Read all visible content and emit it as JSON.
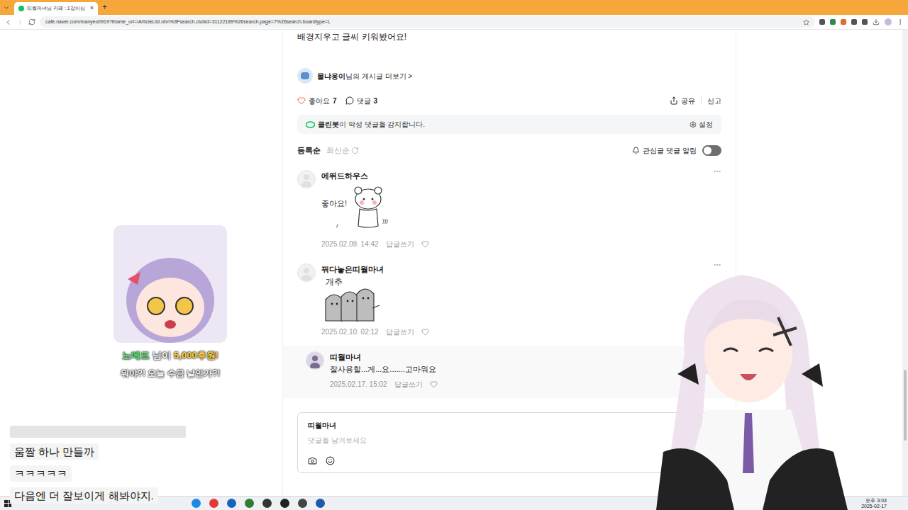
{
  "browser": {
    "tab_title": "띠월마녀님 카페 : 1강이심",
    "url": "cafe.naver.com/manyeo0919?iframe_url=/ArticleList.nhn%3Fsearch.clubid=31122189%26search.page=7%26search.boardtype=L",
    "close": "×",
    "new_tab": "+"
  },
  "post": {
    "text": "배경지우고 글씨 키워봤어요!",
    "author": "물냐옹이",
    "more": "님의 게시글 더보기",
    "arrow": ">"
  },
  "actions": {
    "like_label": "좋아요",
    "like_count": "7",
    "liked": false,
    "comment_label": "댓글",
    "comment_count": "3",
    "share": "공유",
    "report": "신고"
  },
  "cleanbot": {
    "name": "클린봇",
    "text": "이 악성 댓글을 감지합니다.",
    "settings": "설정"
  },
  "sort": [
    {
      "label": "등록순",
      "selected": true
    },
    {
      "label": "최신순",
      "selected": false
    }
  ],
  "notify": {
    "label": "관심글 댓글 알림",
    "on": false
  },
  "comments": [
    {
      "author": "에뛰드하우스",
      "kind": "bear",
      "sticker_text": "좋아요!",
      "date": "2025.02.09. 14:42",
      "reply": "답글쓰기",
      "liked": false,
      "writer": false,
      "text": ""
    },
    {
      "author": "꿔다놓은띠월마녀",
      "kind": "ghosts",
      "sticker_text": "개추",
      "date": "2025.02.10. 02:12",
      "reply": "답글쓰기",
      "liked": false,
      "writer": false,
      "text": ""
    },
    {
      "author": "띠월마녀",
      "kind": "text",
      "sticker_text": "",
      "date": "2025.02.17. 15:02",
      "reply": "답글쓰기",
      "liked": false,
      "writer": true,
      "text": "잘사용할...게...요.......고마워요"
    }
  ],
  "comment_box": {
    "user": "띠월마녀",
    "placeholder": "댓글을 남겨보세요"
  },
  "donation": {
    "name": "노메드",
    "middle": "님이",
    "amount": "5,000후원!",
    "message": "뭐야?! 오늘 수금 날인가?!"
  },
  "chat": [
    {
      "text": "움짤 하나 만들까"
    },
    {
      "text": "ㅋㅋㅋㅋㅋ"
    },
    {
      "text": "다음엔 더 잘보이게 해봐야지."
    }
  ],
  "taskbar": {
    "time": "오후 3:03",
    "date": "2025-02-17"
  }
}
